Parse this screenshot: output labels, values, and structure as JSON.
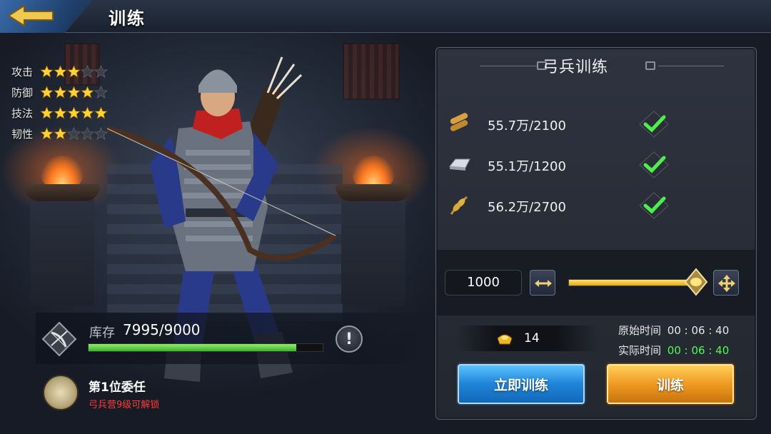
{
  "header": {
    "title": "训练"
  },
  "stats": [
    {
      "label": "攻击",
      "stars": 3,
      "max": 5
    },
    {
      "label": "防御",
      "stars": 4,
      "max": 5
    },
    {
      "label": "技法",
      "stars": 5,
      "max": 5
    },
    {
      "label": "韧性",
      "stars": 2,
      "max": 5
    }
  ],
  "inventory": {
    "label": "库存",
    "value": "7995/9000",
    "fill_fraction": 0.888
  },
  "commission": {
    "title": "第1位委任",
    "subtitle": "弓兵营9级可解锁"
  },
  "panel": {
    "title": "弓兵训练",
    "resources": [
      {
        "icon": "wood-icon",
        "text": "55.7万/2100"
      },
      {
        "icon": "iron-icon",
        "text": "55.1万/1200"
      },
      {
        "icon": "grain-icon",
        "text": "56.2万/2700"
      }
    ],
    "quantity": "1000",
    "slider_fraction": 0.9,
    "gold": "14",
    "original_time_label": "原始时间",
    "original_time": "00 : 06 : 40",
    "actual_time_label": "实际时间",
    "actual_time": "00 : 06 : 40",
    "instant_button": "立即训练",
    "train_button": "训练"
  },
  "colors": {
    "progress": "#3fb02c",
    "slider": "#f0c030",
    "accent_blue": "#1f84d8",
    "accent_gold": "#f09a22",
    "time_green": "#4cff4c",
    "warning_red": "#ff3a3a"
  }
}
